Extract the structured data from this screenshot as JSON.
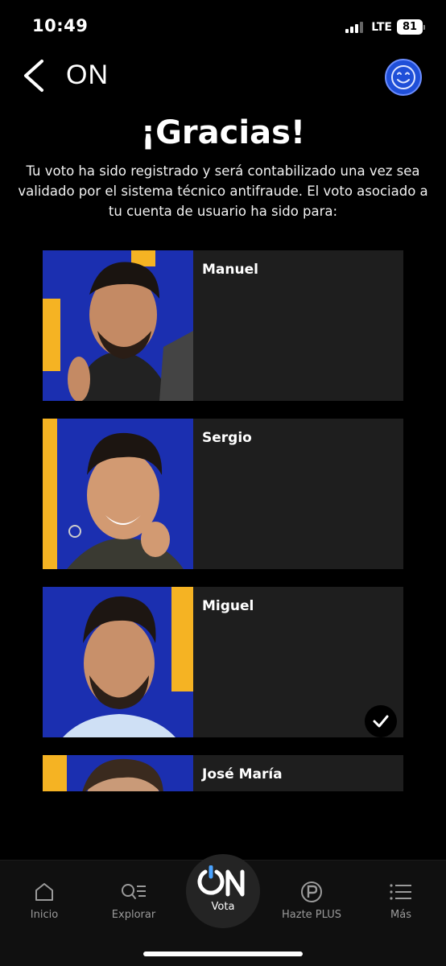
{
  "status_bar": {
    "time": "10:49",
    "network": "LTE",
    "battery": "81"
  },
  "header": {
    "title": "ON",
    "back_icon": "chevron-left-icon",
    "avatar_icon": "smiley-avatar-icon"
  },
  "main": {
    "title": "¡Gracias!",
    "message": "Tu voto ha sido registrado y será contabilizado una vez sea validado por el sistema técnico antifraude. El voto asociado a tu cuenta de usuario ha sido para:",
    "candidates": [
      {
        "name": "Manuel",
        "selected": false
      },
      {
        "name": "Sergio",
        "selected": false
      },
      {
        "name": "Miguel",
        "selected": true
      },
      {
        "name": "José María",
        "selected": false
      }
    ]
  },
  "bottom_nav": {
    "items": [
      {
        "label": "Inicio",
        "icon": "home-icon"
      },
      {
        "label": "Explorar",
        "icon": "explore-icon"
      },
      {
        "label": "Vota",
        "icon": "on-logo-icon"
      },
      {
        "label": "Hazte PLUS",
        "icon": "plus-badge-icon"
      },
      {
        "label": "Más",
        "icon": "menu-icon"
      }
    ]
  },
  "colors": {
    "background": "#000000",
    "card": "#1e1e1e",
    "avatar": "#1f4fd8",
    "photo_bg_blue": "#1b2fb0",
    "photo_accent_yellow": "#f5b323",
    "on_logo_accent": "#4aa3ff"
  }
}
